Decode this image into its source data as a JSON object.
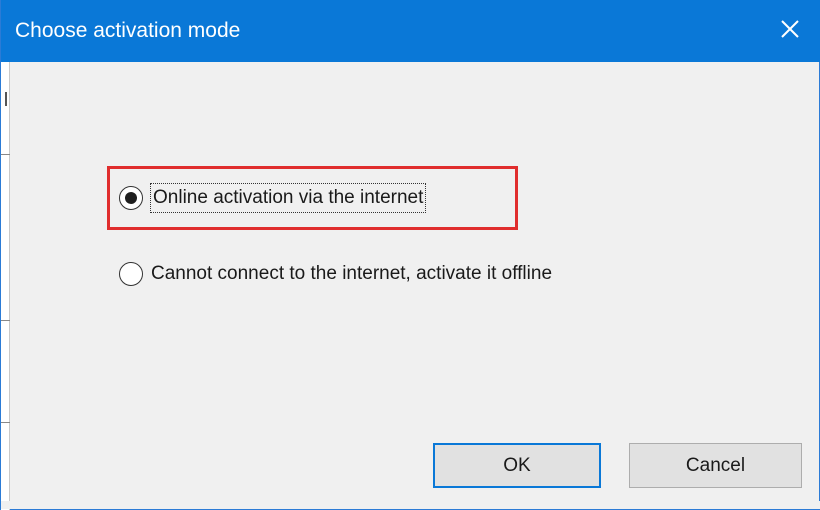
{
  "window": {
    "title": "Choose activation mode",
    "close_icon": "close-icon",
    "titlebar_color": "#0a78d7"
  },
  "options": [
    {
      "label": "Online activation via the internet",
      "selected": true,
      "highlighted": true
    },
    {
      "label": "Cannot connect to the internet, activate it offline",
      "selected": false,
      "highlighted": false
    }
  ],
  "buttons": {
    "ok_label": "OK",
    "cancel_label": "Cancel"
  },
  "colors": {
    "highlight_border": "#e02d2d",
    "default_button_border": "#0a78d7"
  }
}
